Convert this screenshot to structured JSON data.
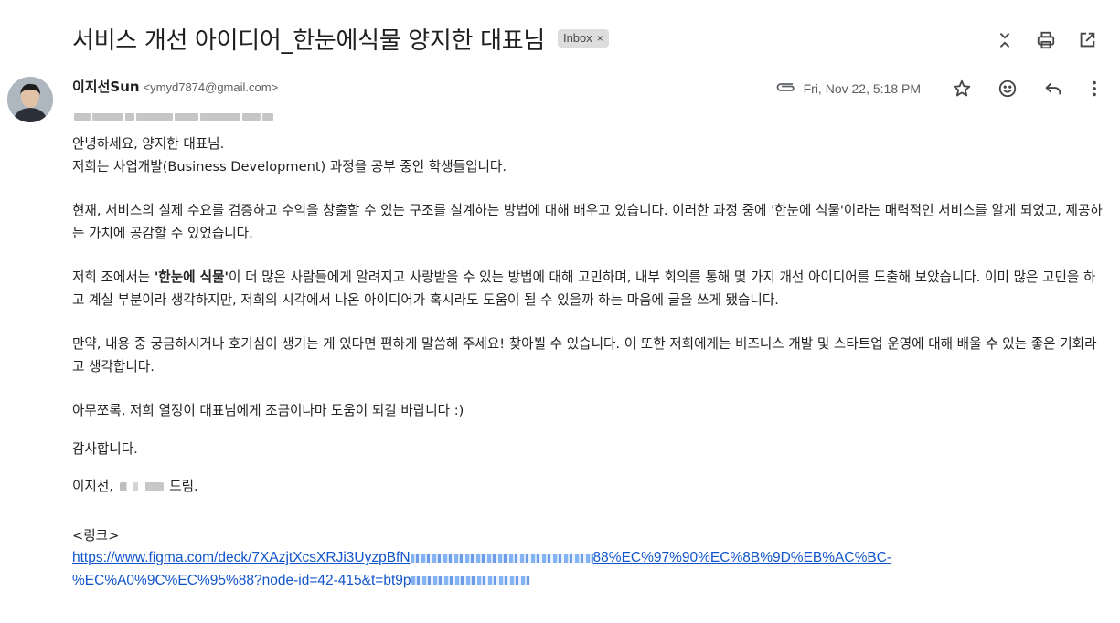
{
  "subject": "서비스 개선 아이디어_한눈에식물 양지한 대표님",
  "label": {
    "text": "Inbox",
    "close": "×"
  },
  "top_actions": [
    {
      "name": "collapse-icon"
    },
    {
      "name": "print-icon"
    },
    {
      "name": "open-new-window-icon"
    }
  ],
  "sender": {
    "name": "이지선Sun",
    "email": "<ymyd7874@gmail.com>"
  },
  "date": "Fri, Nov 22, 5:18 PM",
  "body": {
    "p1": "안녕하세요, 양지한 대표님.\n저희는 사업개발(Business Development) 과정을 공부 중인 학생들입니다.",
    "p2": "현재, 서비스의 실제 수요를 검증하고 수익을 창출할 수 있는 구조를 설계하는 방법에 대해 배우고 있습니다. 이러한 과정 중에 '한눈에 식물'이라는 매력적인 서비스를 알게 되었고, 제공하는 가치에 공감할 수 있었습니다.",
    "p3_before": "저희 조에서는 ",
    "p3_bold": "'한눈에 식물'",
    "p3_after": "이 더 많은 사람들에게 알려지고 사랑받을 수 있는 방법에 대해 고민하며, 내부 회의를 통해 몇 가지 개선 아이디어를 도출해 보았습니다. 이미 많은 고민을 하고 계실 부분이라 생각하지만, 저희의 시각에서 나온 아이디어가 혹시라도 도움이 될 수 있을까 하는 마음에 글을 쓰게 됐습니다.",
    "p4": "만약, 내용 중 궁금하시거나 호기심이 생기는 게 있다면 편하게 말씀해 주세요! 찾아뵐 수 있습니다. 이 또한 저희에게는 비즈니스 개발 및 스타트업 운영에 대해 배울 수 있는 좋은 기회라고 생각합니다.",
    "p5": "아무쪼록, 저희 열정이 대표님에게 조금이나마 도움이 되길 바랍니다 :)",
    "p6": "감사합니다.",
    "sign_prefix": "이지선, ",
    "sign_suffix": " 드림.",
    "link_label": "<링크>",
    "link_part1": "https://www.figma.com/deck/7XAzjtXcsXRJi3UyzpBfN",
    "link_part2": "88%EC%97%90%EC%8B%9D%EB%AC%BC-",
    "link_part3": "%EC%A0%9C%EC%95%88?node-id=42-415&t=bt9p"
  }
}
